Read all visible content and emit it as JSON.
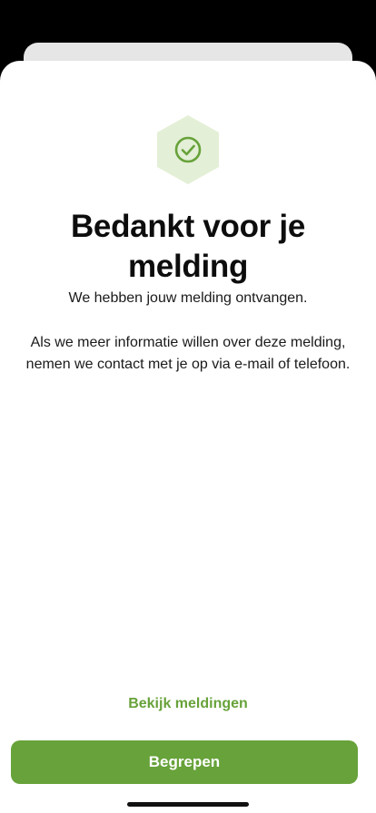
{
  "confirmation": {
    "title": "Bedankt voor je melding",
    "subtitle": "We hebben jouw melding ontvangen.",
    "info": "Als we meer informatie willen over deze melding, nemen we contact met je op via e-mail of telefoon.",
    "icon": "check-circle-icon"
  },
  "actions": {
    "view_reports_label": "Bekijk meldingen",
    "confirm_label": "Begrepen"
  },
  "colors": {
    "accent": "#67a23a",
    "icon_background": "#e3efd6",
    "text": "#0d0d0d"
  }
}
